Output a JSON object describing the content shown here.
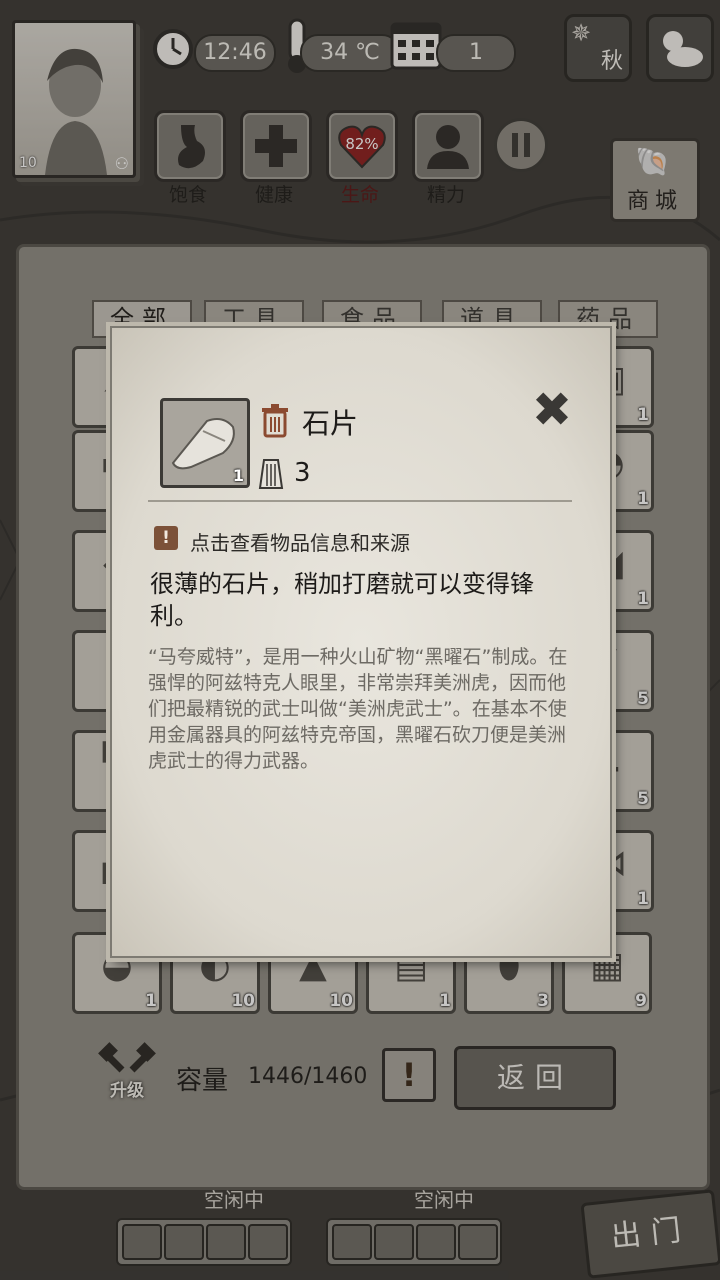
{
  "hud": {
    "time": "12:46",
    "temperature": "34 ℃",
    "day": "1",
    "season": "秋",
    "player_level": "10",
    "shop_label": "商城",
    "stats": [
      {
        "label": "饱食",
        "icon": "stomach-icon"
      },
      {
        "label": "健康",
        "icon": "health-cross-icon"
      },
      {
        "label": "生命",
        "icon": "heart-icon",
        "value": "82%"
      },
      {
        "label": "精力",
        "icon": "energy-person-icon"
      }
    ]
  },
  "inventory": {
    "tabs": [
      "全部",
      "工具",
      "食品",
      "道具",
      "药品"
    ],
    "active_tab": "全部",
    "left_column_counts": [
      "",
      "",
      "",
      "",
      "",
      ""
    ],
    "right_column_counts": [
      "1",
      "1",
      "1",
      "5",
      "5",
      "1"
    ],
    "bottom_row_counts": [
      "1",
      "10",
      "10",
      "1",
      "3",
      "9"
    ],
    "capacity_label": "容量",
    "capacity_value": "1446/1460",
    "upgrade_label": "升级",
    "warning_glyph": "!",
    "back_label": "返回"
  },
  "bottom_bar": {
    "companion_status": [
      "空闲中",
      "空闲中"
    ],
    "go_out_label": "出门"
  },
  "item_popup": {
    "name": "石片",
    "slot_count": "1",
    "weight": "3",
    "hint": "点击查看物品信息和来源",
    "description": "很薄的石片，稍加打磨就可以变得锋利。",
    "lore": "“马夸威特”，是用一种火山矿物“黑曜石”制成。在强悍的阿兹特克人眼里，非常崇拜美洲虎，因而他们把最精锐的武士叫做“美洲虎武士”。在基本不使用金属器具的阿兹特克帝国，黑曜石砍刀便是美洲虎武士的得力武器。",
    "close_glyph": "✖"
  }
}
